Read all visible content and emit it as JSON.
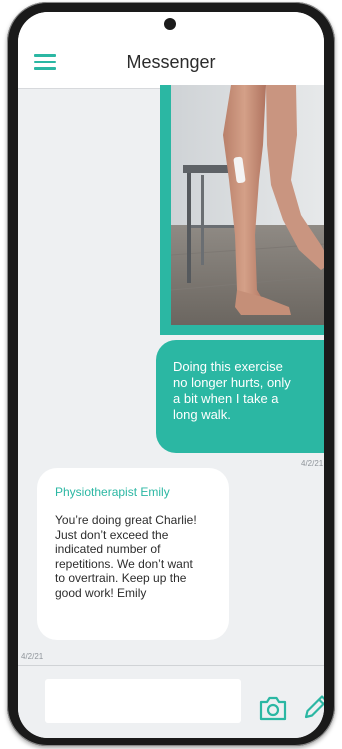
{
  "app": {
    "title": "Messenger",
    "accent_color": "#2bb7a3"
  },
  "header": {
    "menu_icon": "hamburger-menu-icon"
  },
  "conversation": {
    "outgoing": {
      "image": "exercise-photo-legs-standing-by-chair",
      "text": "Doing this exercise\nno longer hurts, only\na bit when I take a\nlong walk.",
      "date": "4/2/21"
    },
    "incoming": {
      "sender": "Physiotherapist Emily",
      "text": "You’re doing great Charlie!\nJust don’t exceed the\nindicated number of\nrepetitions. We don’t want\nto overtrain. Keep up the\ngood work! Emily",
      "date": "4/2/21"
    }
  },
  "composer": {
    "input_value": "",
    "placeholder": "",
    "camera_icon": "camera-icon",
    "compose_icon": "pencil-icon"
  }
}
